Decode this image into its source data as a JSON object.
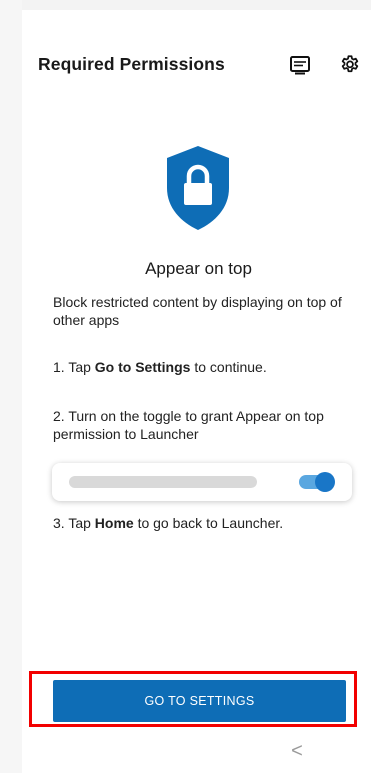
{
  "header": {
    "title": "Required Permissions",
    "icons": [
      "screen-icon",
      "gear-icon"
    ]
  },
  "permission": {
    "icon": "lock-shield-icon",
    "title": "Appear on top",
    "description": "Block restricted content by displaying on top of other apps",
    "step1": {
      "prefix": "1. Tap ",
      "bold": "Go to Settings",
      "suffix": " to continue."
    },
    "step2": "2. Turn on the toggle to grant Appear on top permission to Launcher",
    "toggle_on": true,
    "step3": {
      "prefix": "3. Tap ",
      "bold": "Home",
      "suffix": " to go back to Launcher."
    }
  },
  "action": {
    "button_label": "GO TO SETTINGS"
  },
  "nav": {
    "back_glyph": "<"
  },
  "colors": {
    "accent": "#0e6db6",
    "highlight": "#f20000",
    "toggle_track": "#5aa7e0"
  }
}
